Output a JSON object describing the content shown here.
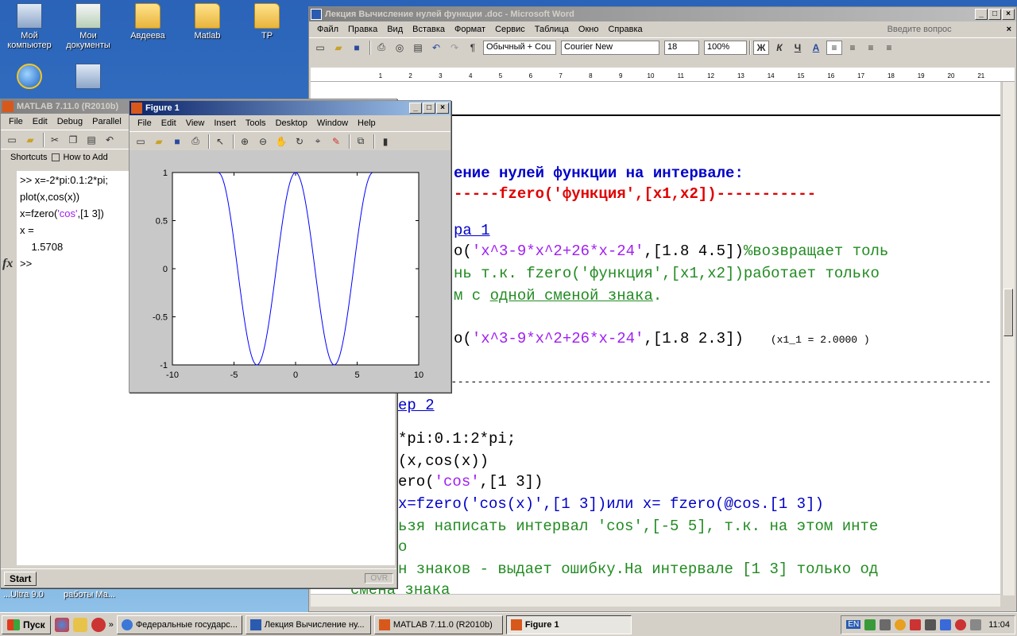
{
  "desktop": {
    "icons": [
      {
        "label": "Мой компьютер",
        "icon": "my-computer-icon"
      },
      {
        "label": "Мои документы",
        "icon": "my-documents-icon"
      },
      {
        "label": "Авдеева",
        "icon": "folder-icon"
      },
      {
        "label": "Matlab",
        "icon": "folder-icon"
      },
      {
        "label": "TP",
        "icon": "folder-icon"
      },
      {
        "label": "",
        "icon": "internet-explorer-icon"
      },
      {
        "label": "",
        "icon": "network-computer-icon"
      }
    ],
    "behind_text_1": "...Ultra 9.0",
    "behind_text_2": "работы Ма..."
  },
  "word": {
    "title": "Лекция Вычисление нулей функции .doc - Microsoft Word",
    "menu": [
      "Файл",
      "Правка",
      "Вид",
      "Вставка",
      "Формат",
      "Сервис",
      "Таблица",
      "Окно",
      "Справка"
    ],
    "help_placeholder": "Введите вопрос",
    "style": "Обычный + Cou",
    "font": "Courier New",
    "size": "18",
    "zoom": "100%",
    "bold_label": "Ж",
    "italic_label": "К",
    "underline_label": "Ч",
    "font_color_label": "A",
    "ruler_marks": [
      "1",
      "2",
      "3",
      "4",
      "5",
      "6",
      "7",
      "8",
      "9",
      "10",
      "11",
      "12",
      "13",
      "14",
      "15",
      "16",
      "17",
      "18",
      "19",
      "20",
      "21"
    ],
    "doc": {
      "l1": "ение нулей функции на интервале:",
      "l2a": "-----",
      "l2b": "fzero('функция',[x1,x2])",
      "l2c": "-----------",
      "l3": "ра 1",
      "l4a": "о(",
      "l4b": "'x^3-9*x^2+26*x-24'",
      "l4c": ",[1.8 4.5])",
      "l4d": "%возвращает толь",
      "l5a": "нь т.к. fzero('функция',[x1,x2])работает только",
      "l6a": "м с ",
      "l6b": "одной сменой знака",
      "l6c": ".",
      "l7a": "о(",
      "l7b": "'x^3-9*x^2+26*x-24'",
      "l7c": ",[1.8 2.3])",
      "l7d": "(x1_1 = 2.0000 )",
      "l8": "------------------------------------------------------------------------------------------",
      "l9": "ер 2",
      "l10": "*pi:0.1:2*pi;",
      "l11": "(x,cos(x))",
      "l12a": "ero(",
      "l12b": "'cos'",
      "l12c": ",[1 3])",
      "l13": " x=fzero('cos(x)',[1 3])или x= fzero(@cos.[1 3])",
      "l14": "ьзя написать интервал 'cos',[-5 5], т.к. на этом инте",
      "l15": "о",
      "l16": "н знаков - выдает ошибку.На интервале [1 3] только од",
      "l17": "смена знака"
    }
  },
  "matlab": {
    "title": "MATLAB  7.11.0 (R2010b)",
    "menu": [
      "File",
      "Edit",
      "Debug",
      "Parallel",
      "D"
    ],
    "shortcuts_label": "Shortcuts",
    "how_to_add": "How to Add",
    "lines": [
      ">> x=-2*pi:0.1:2*pi;",
      "plot(x,cos(x))",
      "x=fzero('cos',[1 3])",
      "x =",
      "    1.5708",
      ">>"
    ],
    "start_label": "Start",
    "ovr_label": "OVR"
  },
  "figure": {
    "title": "Figure 1",
    "menu": [
      "File",
      "Edit",
      "View",
      "Insert",
      "Tools",
      "Desktop",
      "Window",
      "Help"
    ]
  },
  "chart_data": {
    "type": "line",
    "function": "cos(x)",
    "x_start": -6.2832,
    "x_end": 6.2832,
    "x_step": 0.1,
    "xlim": [
      -10,
      10
    ],
    "ylim": [
      -1,
      1
    ],
    "xticks": [
      "-10",
      "-5",
      "0",
      "5",
      "10"
    ],
    "yticks": [
      "1",
      "0.5",
      "0",
      "-0.5",
      "-1"
    ],
    "line_color": "#0000ff",
    "title": "",
    "xlabel": "",
    "ylabel": "",
    "grid": false
  },
  "taskbar": {
    "start": "Пуск",
    "tasks": [
      {
        "label": "Федеральные государс...",
        "active": false
      },
      {
        "label": "Лекция Вычисление ну...",
        "active": false
      },
      {
        "label": "MATLAB  7.11.0 (R2010b)",
        "active": false
      },
      {
        "label": "Figure 1",
        "active": true
      }
    ],
    "lang": "EN",
    "time": "11:04"
  }
}
